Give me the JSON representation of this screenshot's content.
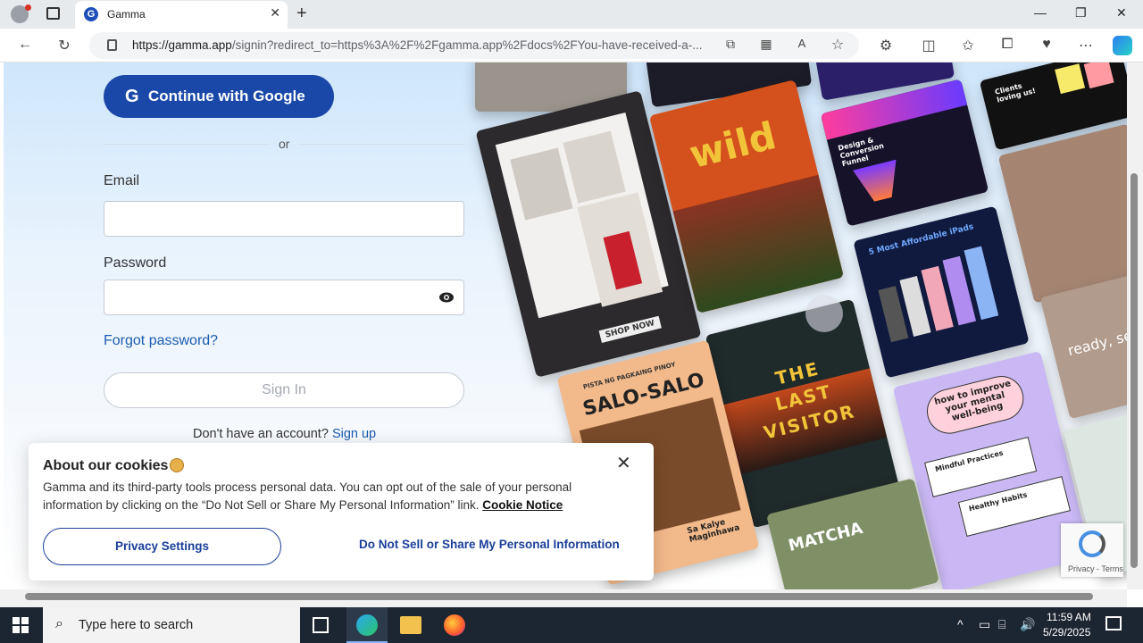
{
  "browser": {
    "tab_title": "Gamma",
    "tab_favicon": "G",
    "url_host": "https://gamma.app",
    "url_rest": "/signin?redirect_to=https%3A%2F%2Fgamma.app%2Fdocs%2FYou-have-received-a-..."
  },
  "signin": {
    "google_button": "Continue with Google",
    "or": "or",
    "email_label": "Email",
    "password_label": "Password",
    "forgot": "Forgot password?",
    "signin_button": "Sign In",
    "no_account": "Don't have an account?",
    "signup": "Sign up"
  },
  "collage": {
    "wild": "wild",
    "design_funnel": "Design & Conversion Funnel",
    "clients": "Clients loving us!",
    "ipads": "5 Most Affordable iPads",
    "last_visitor": "THE LAST VISITOR",
    "salo_salo": "SALO-SALO",
    "salo_small": "PISTA NG PAGKAING PINOY",
    "sa_kalye": "Sa Kalye Maginhawa",
    "mental": "how to improve your mental well-being",
    "mindful": "Mindful Practices",
    "habits": "Healthy Habits",
    "matcha": "MATCHA",
    "ready": "ready, se",
    "shop_now": "SHOP NOW"
  },
  "cookie": {
    "title": "About our cookies",
    "text": "Gamma and its third-party tools process personal data. You can opt out of the sale of your personal information by clicking on the “Do Not Sell or Share My Personal Information” link.",
    "notice_link": "Cookie Notice",
    "privacy_button": "Privacy Settings",
    "dns_button": "Do Not Sell or Share My Personal Information"
  },
  "recaptcha": {
    "text": "Privacy - Terms"
  },
  "taskbar": {
    "search_placeholder": "Type here to search",
    "time": "11:59 AM",
    "date": "5/29/2025"
  },
  "colors": {
    "accent": "#1a48a8",
    "link": "#1a5bb0"
  }
}
